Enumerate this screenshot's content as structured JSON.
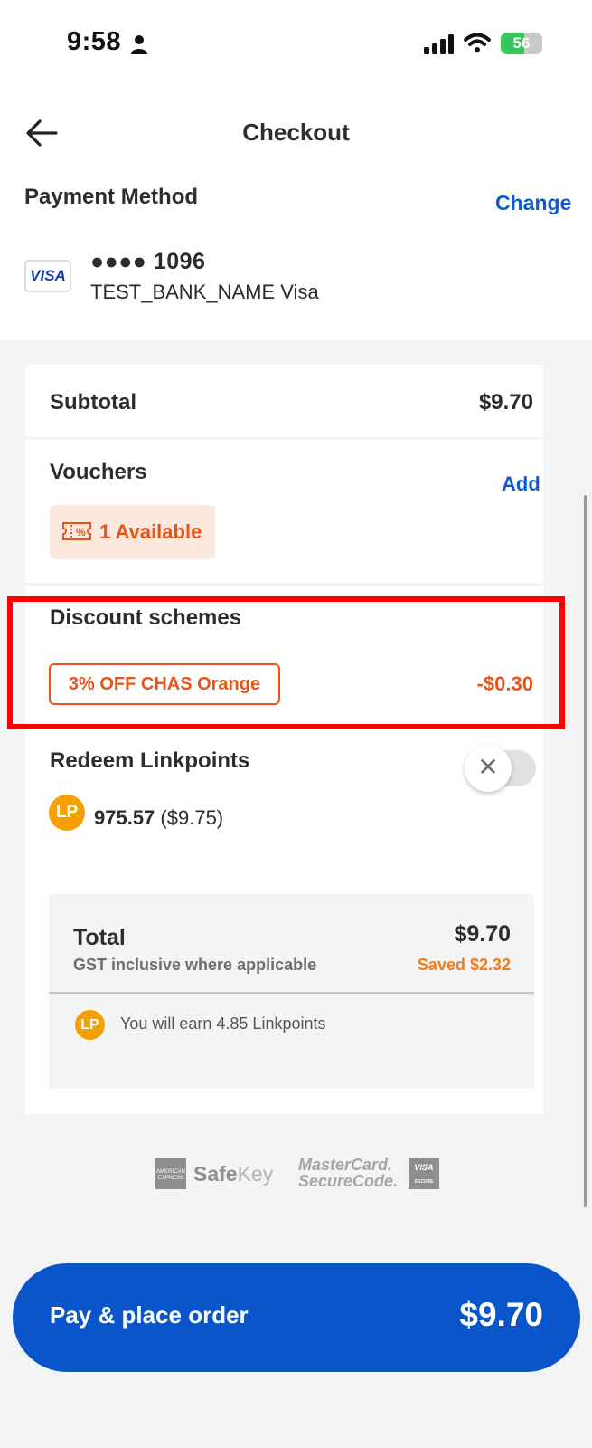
{
  "status_bar": {
    "time": "9:58",
    "battery": "56"
  },
  "header": {
    "title": "Checkout"
  },
  "payment_method": {
    "title": "Payment Method",
    "change_label": "Change",
    "card_brand": "VISA",
    "card_number": "●●●● 1096",
    "bank_name": "TEST_BANK_NAME Visa"
  },
  "subtotal": {
    "label": "Subtotal",
    "value": "$9.70"
  },
  "vouchers": {
    "label": "Vouchers",
    "add_label": "Add",
    "available_label": "1 Available"
  },
  "discount": {
    "label": "Discount schemes",
    "tag": "3% OFF CHAS Orange",
    "value": "-$0.30"
  },
  "linkpoints": {
    "label": "Redeem Linkpoints",
    "badge": "LP",
    "points": "975.57",
    "points_value": "($9.75)",
    "toggle_symbol": "✕"
  },
  "total": {
    "label": "Total",
    "value": "$9.70",
    "gst_note": "GST inclusive where applicable",
    "saved": "Saved $2.32",
    "earn_badge": "LP",
    "earn_text": "You will earn 4.85 Linkpoints"
  },
  "security_logos": {
    "amex": "AMERICAN EXPRESS",
    "safekey_bold": "Safe",
    "safekey_light": "Key",
    "mastercard": "MasterCard.",
    "securecode": "SecureCode.",
    "visa": "VISA",
    "visa_secure": "SECURE"
  },
  "pay_button": {
    "label": "Pay & place order",
    "amount": "$9.70"
  },
  "colors": {
    "primary_blue": "#0a55c9",
    "accent_orange": "#e8541a",
    "highlight_red": "#ff0000",
    "lp_yellow": "#f5a000"
  }
}
